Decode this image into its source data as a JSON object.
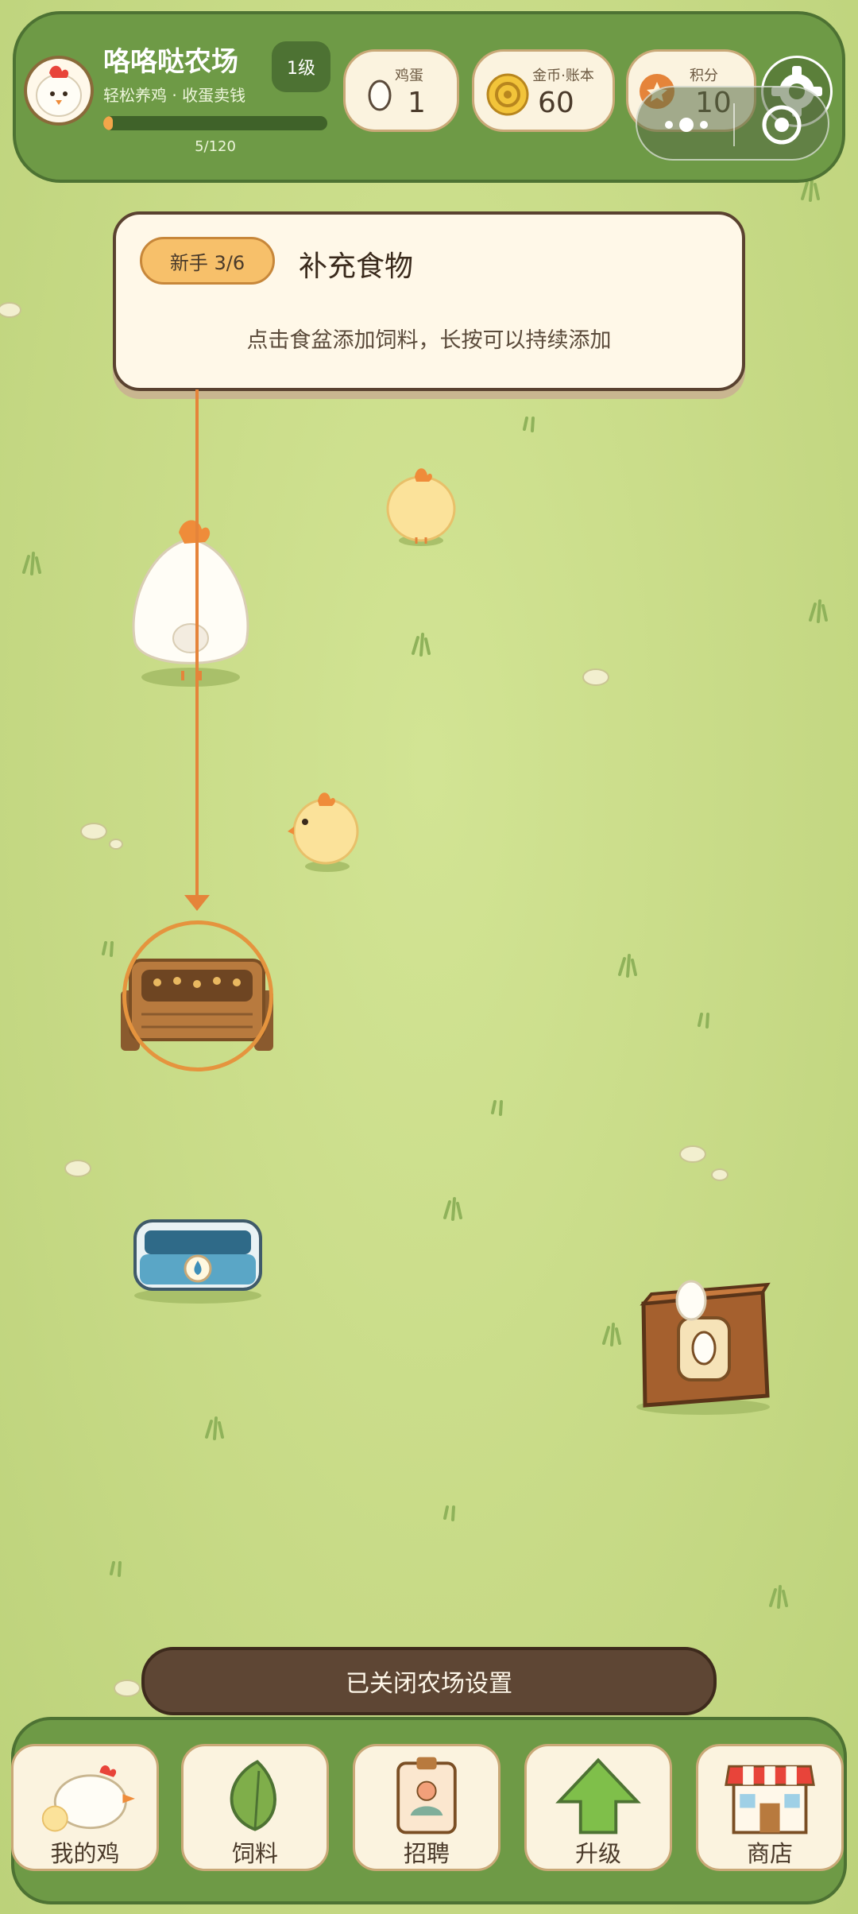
{
  "header": {
    "farm_name": "咯咯哒农场",
    "subtitle": "轻松养鸡 · 收蛋卖钱",
    "level": "1级",
    "xp_text": "5/120",
    "xp_fraction": 0.042,
    "stats": {
      "eggs": {
        "label": "鸡蛋",
        "value": "1",
        "icon": "egg-icon"
      },
      "coins": {
        "label": "金币·账本",
        "value": "60",
        "icon": "coin-icon"
      },
      "points": {
        "label": "积分",
        "value": "10",
        "icon": "star-icon"
      }
    },
    "settings_icon": "gear-icon"
  },
  "tutorial": {
    "badge": "新手 3/6",
    "title": "补充食物",
    "description": "点击食盆添加饲料，长按可以持续添加"
  },
  "toast": {
    "message": "已关闭农场设置"
  },
  "nav": {
    "items": [
      {
        "label": "我的鸡",
        "icon": "chicken-icon"
      },
      {
        "label": "饲料",
        "icon": "leaf-icon"
      },
      {
        "label": "招聘",
        "icon": "badge-card-icon"
      },
      {
        "label": "升级",
        "icon": "up-arrow-icon"
      },
      {
        "label": "商店",
        "icon": "shop-icon"
      }
    ]
  },
  "colors": {
    "grass": "#c8dc86",
    "header_green": "#6e9a46",
    "accent_orange": "#e5843a",
    "toast_brown": "#5e4634"
  }
}
